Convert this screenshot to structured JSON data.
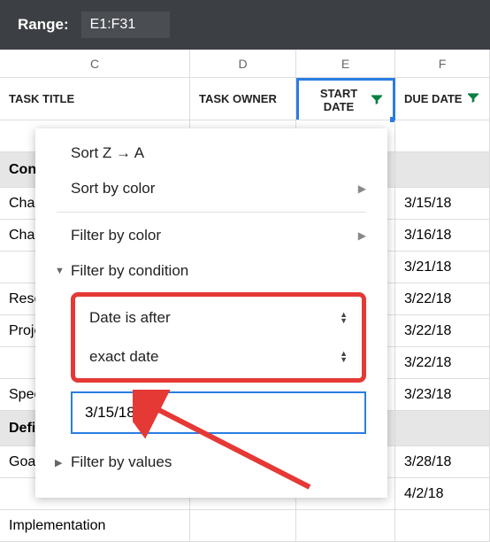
{
  "range_bar": {
    "label": "Range:",
    "value": "E1:F31"
  },
  "columns": {
    "c": "C",
    "d": "D",
    "e": "E",
    "f": "F"
  },
  "headers": {
    "task_title": "TASK TITLE",
    "task_owner": "TASK OWNER",
    "start_date": "START DATE",
    "due_date": "DUE DATE"
  },
  "rows": [
    {
      "type": "blank"
    },
    {
      "type": "category",
      "title": "Conception"
    },
    {
      "type": "data",
      "title": "Charter",
      "due": "3/15/18"
    },
    {
      "type": "data",
      "title": "Charter Revisions",
      "due": "3/16/18"
    },
    {
      "type": "data",
      "title": "",
      "due": "3/21/18"
    },
    {
      "type": "data",
      "title": "Research",
      "due": "3/22/18"
    },
    {
      "type": "data",
      "title": "Projections",
      "due": "3/22/18"
    },
    {
      "type": "data",
      "title": "",
      "due": "3/22/18"
    },
    {
      "type": "data",
      "title": "Specifications",
      "due": "3/23/18"
    },
    {
      "type": "category",
      "title": "Definition"
    },
    {
      "type": "data",
      "title": "Goal Setting",
      "due": "3/28/18"
    },
    {
      "type": "data",
      "title": "",
      "due": "4/2/18"
    },
    {
      "type": "data",
      "title": "Implementation",
      "due": ""
    }
  ],
  "filter_panel": {
    "sort_za": "Sort Z → A",
    "sort_color": "Sort by color",
    "filter_color": "Filter by color",
    "filter_condition": "Filter by condition",
    "condition_type": "Date is after",
    "date_mode": "exact date",
    "date_value": "3/15/18",
    "filter_values": "Filter by values"
  }
}
